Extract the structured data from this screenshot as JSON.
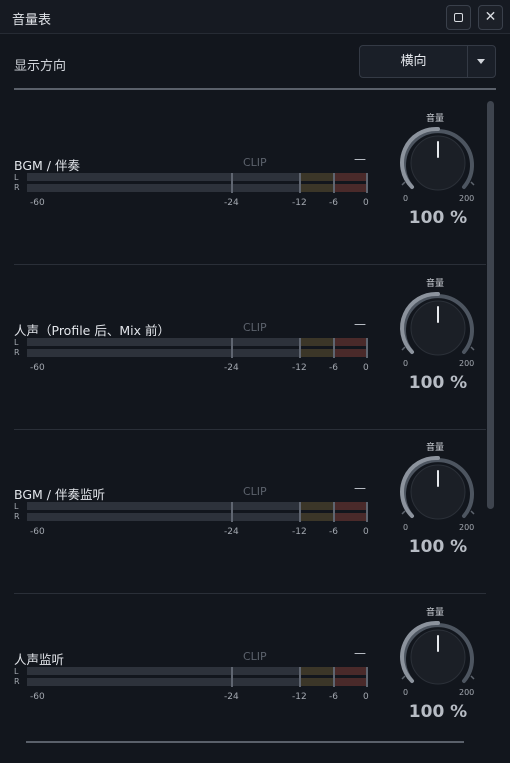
{
  "window": {
    "title": "音量表"
  },
  "display": {
    "label": "显示方向",
    "selected": "横向"
  },
  "meter_scale": [
    "-60",
    "-24",
    "-12",
    "-6",
    "0"
  ],
  "channel_labels": {
    "clip": "CLIP",
    "peak": "—",
    "left": "L",
    "right": "R"
  },
  "knob_labels": {
    "title": "音量",
    "min": "0",
    "max": "200"
  },
  "channels": [
    {
      "name": "BGM / 伴奏",
      "volume": "100 %"
    },
    {
      "name": "人声（Profile 后、Mix 前）",
      "volume": "100 %"
    },
    {
      "name": "BGM / 伴奏监听",
      "volume": "100 %"
    },
    {
      "name": "人声监听",
      "volume": "100 %"
    }
  ],
  "colors": {
    "background": "#12161d",
    "knob_arc": "#4d5560",
    "meter_yellow_zone": "#3b3628",
    "meter_red_zone": "#4a2a2a"
  }
}
